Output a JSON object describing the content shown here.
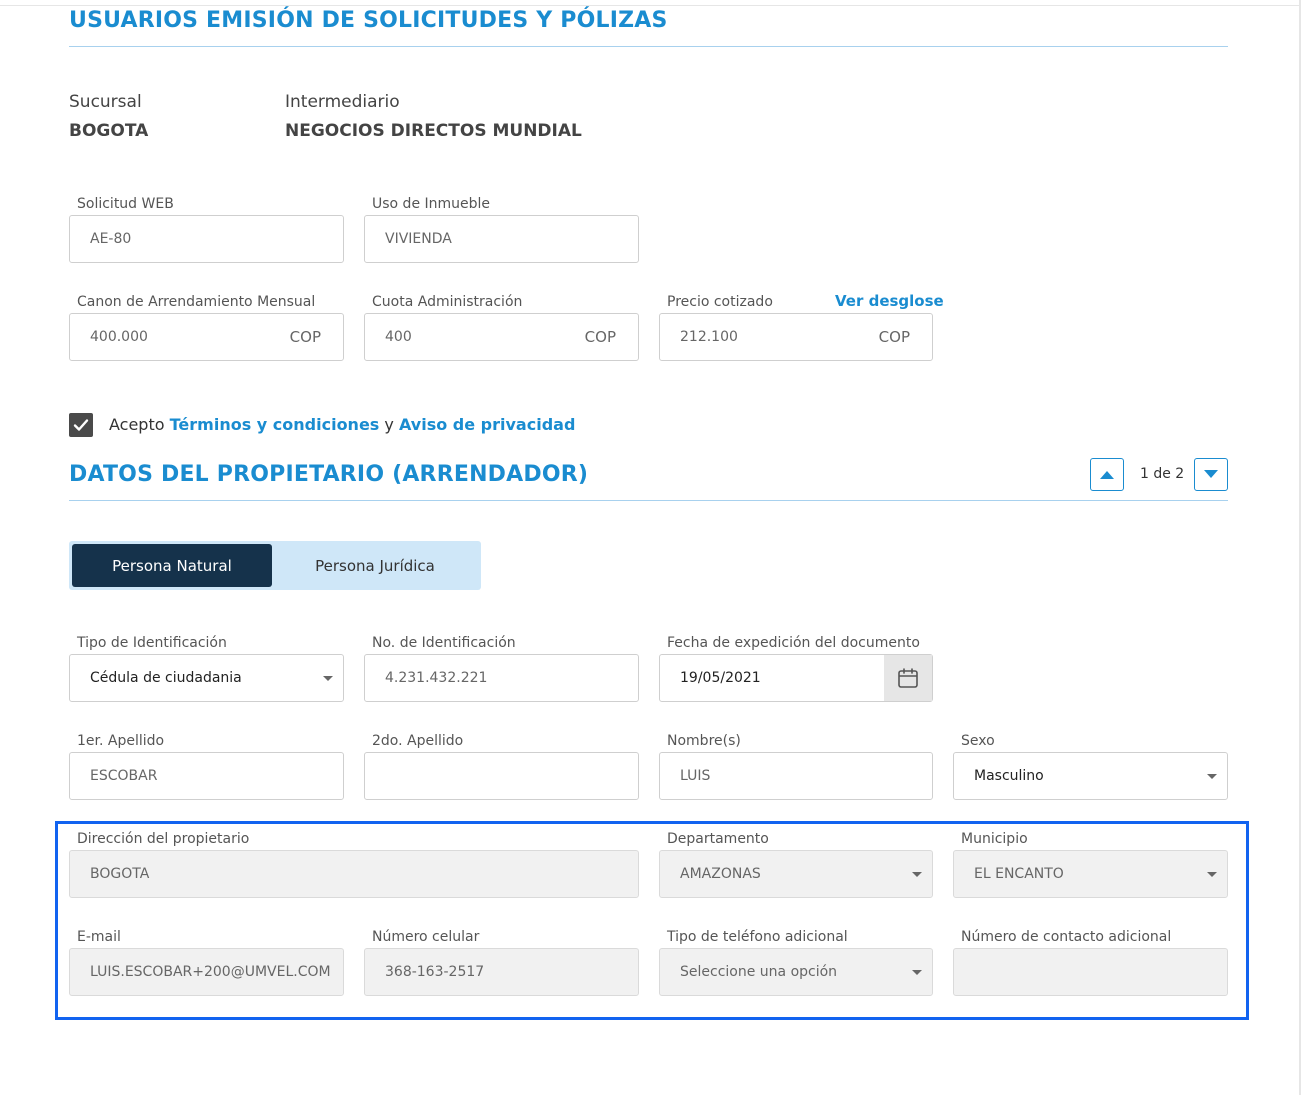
{
  "header": {
    "title": "USUARIOS EMISIÓN DE SOLICITUDES Y PÓLIZAS"
  },
  "info": {
    "sucursal_label": "Sucursal",
    "sucursal_value": "BOGOTA",
    "intermediario_label": "Intermediario",
    "intermediario_value": "NEGOCIOS DIRECTOS MUNDIAL"
  },
  "request": {
    "solicitud_web": {
      "label": "Solicitud WEB",
      "value": "AE-80"
    },
    "uso_inmueble": {
      "label": "Uso de Inmueble",
      "value": "VIVIENDA"
    },
    "canon": {
      "label": "Canon de Arrendamiento Mensual",
      "value": "400.000",
      "currency": "COP"
    },
    "cuota": {
      "label": "Cuota Administración",
      "value": "400",
      "currency": "COP"
    },
    "precio": {
      "label": "Precio cotizado",
      "value": "212.100",
      "currency": "COP",
      "link": "Ver desglose"
    }
  },
  "terms": {
    "checked": true,
    "prefix": "Acepto",
    "terms_link": "Términos y condiciones",
    "connector": "y",
    "privacy_link": "Aviso de privacidad"
  },
  "owner": {
    "title": "DATOS DEL PROPIETARIO (ARRENDADOR)",
    "pager": "1 de 2",
    "tabs": {
      "natural": "Persona Natural",
      "juridica": "Persona Jurídica"
    },
    "tipo_id": {
      "label": "Tipo de Identificación",
      "value": "Cédula de ciudadania"
    },
    "no_id": {
      "label": "No. de Identificación",
      "value": "4.231.432.221"
    },
    "fecha": {
      "label": "Fecha de expedición del documento",
      "value": "19/05/2021"
    },
    "apellido1": {
      "label": "1er. Apellido",
      "value": "ESCOBAR"
    },
    "apellido2": {
      "label": "2do. Apellido",
      "value": ""
    },
    "nombre": {
      "label": "Nombre(s)",
      "value": "LUIS"
    },
    "sexo": {
      "label": "Sexo",
      "value": "Masculino"
    },
    "direccion": {
      "label": "Dirección del propietario",
      "value": "BOGOTA"
    },
    "departamento": {
      "label": "Departamento",
      "value": "AMAZONAS"
    },
    "municipio": {
      "label": "Municipio",
      "value": "EL ENCANTO"
    },
    "email": {
      "label": "E-mail",
      "value": "LUIS.ESCOBAR+200@UMVEL.COM"
    },
    "celular": {
      "label": "Número celular",
      "value": "368-163-2517"
    },
    "tipo_tel": {
      "label": "Tipo de teléfono adicional",
      "value": "Seleccione una opción"
    },
    "contacto": {
      "label": "Número de contacto adicional",
      "value": ""
    }
  },
  "colors": {
    "accent": "#1a8cd0",
    "dark": "#15324b",
    "highlight": "#1163f0"
  }
}
